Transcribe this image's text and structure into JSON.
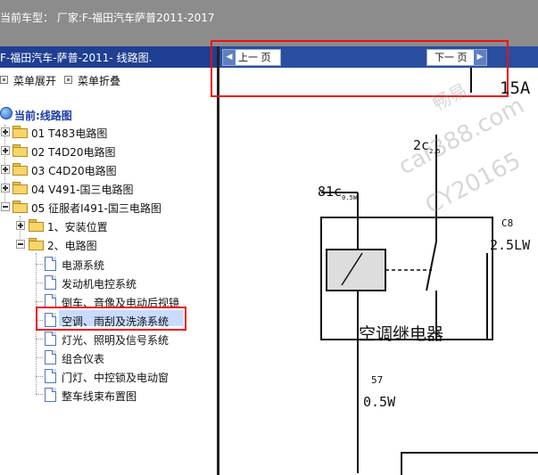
{
  "header": {
    "title": "当前车型： 厂家:F-福田汽车萨普2011-2017"
  },
  "sidebar": {
    "title": "F-福田汽车-萨普-2011- 线路图.",
    "expand_label": "菜单展开",
    "collapse_label": "菜单折叠",
    "root_label": "当前:线路图",
    "folders": [
      "01 T483电路图",
      "02 T4D20电路图",
      "03 C4D20电路图",
      "04 V491-国三电路图",
      "05 征服者I491-国三电路图"
    ],
    "subfolders": [
      "1、安装位置",
      "2、电路图"
    ],
    "pages": [
      "电源系统",
      "发动机电控系统",
      "倒车、音像及电动后视镜",
      "空调、雨刮及洗涤系统",
      "灯光、照明及信号系统",
      "组合仪表",
      "门灯、中控锁及电动窗",
      "整车线束布置图"
    ]
  },
  "nav": {
    "prev_label": "上一 页",
    "next_label": "下一 页",
    "prev_arrow": "◀",
    "next_arrow": "▶"
  },
  "diagram": {
    "fuse_label": "15A",
    "wire_2c": "2c",
    "wire_2c_sub": "2.5",
    "wire_81c": "81c",
    "wire_81c_sub": "0.5W",
    "c8_label": "C8",
    "c8_wire": "2.5LW",
    "relay_label": "空调继电器",
    "w57": "57",
    "w57_wire": "0.5W"
  },
  "watermark": {
    "brand": "畅易",
    "site": "car388.com",
    "code": "CY20165"
  },
  "colors": {
    "topbar": "#8c8c8c",
    "sidebar_header": "#1f3f92",
    "navbar": "#2a4ea0",
    "highlight": "#e11111",
    "selected": "#c9dcff"
  }
}
